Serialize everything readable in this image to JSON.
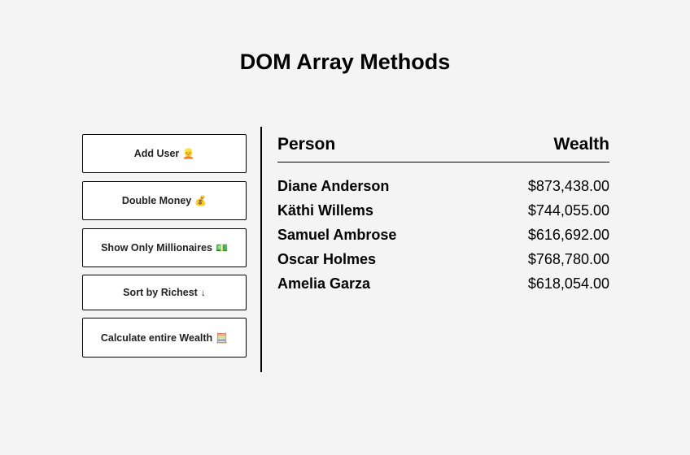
{
  "page": {
    "title": "DOM Array Methods"
  },
  "buttons": {
    "add_user": {
      "label": "Add User",
      "emoji": "👱"
    },
    "double_money": {
      "label": "Double Money",
      "emoji": "💰"
    },
    "show_millionaires": {
      "label": "Show Only Millionaires",
      "emoji": "💵"
    },
    "sort_richest": {
      "label": "Sort by Richest",
      "emoji": "↓"
    },
    "calculate_wealth": {
      "label": "Calculate entire Wealth",
      "emoji": "🧮"
    }
  },
  "table": {
    "header_person": "Person",
    "header_wealth": "Wealth",
    "rows": [
      {
        "name": "Diane Anderson",
        "wealth": "$873,438.00"
      },
      {
        "name": "Käthi Willems",
        "wealth": "$744,055.00"
      },
      {
        "name": "Samuel Ambrose",
        "wealth": "$616,692.00"
      },
      {
        "name": "Oscar Holmes",
        "wealth": "$768,780.00"
      },
      {
        "name": "Amelia Garza",
        "wealth": "$618,054.00"
      }
    ]
  }
}
